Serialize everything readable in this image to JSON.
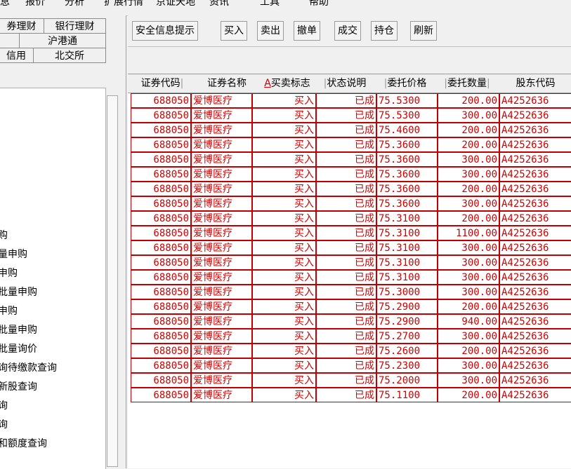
{
  "menu": {
    "items": [
      "息",
      "报价",
      "分析",
      "扩展行情",
      "京证天地",
      "资讯",
      "工具",
      "帮助"
    ]
  },
  "left": {
    "tabs": [
      "券理财",
      "银行理财",
      "沪港通",
      "信用",
      "北交所"
    ],
    "items": [
      "购",
      "量申购",
      "申购",
      "批量申购",
      "申购",
      "批量申购",
      "批量询价",
      "询待缴款查询",
      "新股查询",
      "询",
      "询",
      "和额度查询"
    ]
  },
  "toolbar": {
    "buttons": [
      "安全信息提示",
      "买入",
      "卖出",
      "撤单",
      "成交",
      "持仓",
      "刷新"
    ]
  },
  "table": {
    "headers": [
      "证券代码",
      "证券名称",
      "买卖标志",
      "状态说明",
      "委托价格",
      "委托数量",
      "股东代码"
    ],
    "sort_mark": "A",
    "rows": [
      [
        "688050",
        "爱博医疗",
        "买入",
        "已成",
        "75.5300",
        "200.00",
        "A4252636"
      ],
      [
        "688050",
        "爱博医疗",
        "买入",
        "已成",
        "75.5300",
        "300.00",
        "A4252636"
      ],
      [
        "688050",
        "爱博医疗",
        "买入",
        "已成",
        "75.4600",
        "200.00",
        "A4252636"
      ],
      [
        "688050",
        "爱博医疗",
        "买入",
        "已成",
        "75.3600",
        "200.00",
        "A4252636"
      ],
      [
        "688050",
        "爱博医疗",
        "买入",
        "已成",
        "75.3600",
        "300.00",
        "A4252636"
      ],
      [
        "688050",
        "爱博医疗",
        "买入",
        "已成",
        "75.3600",
        "300.00",
        "A4252636"
      ],
      [
        "688050",
        "爱博医疗",
        "买入",
        "已成",
        "75.3600",
        "200.00",
        "A4252636"
      ],
      [
        "688050",
        "爱博医疗",
        "买入",
        "已成",
        "75.3600",
        "300.00",
        "A4252636"
      ],
      [
        "688050",
        "爱博医疗",
        "买入",
        "已成",
        "75.3100",
        "200.00",
        "A4252636"
      ],
      [
        "688050",
        "爱博医疗",
        "买入",
        "已成",
        "75.3100",
        "1100.00",
        "A4252636"
      ],
      [
        "688050",
        "爱博医疗",
        "买入",
        "已成",
        "75.3100",
        "300.00",
        "A4252636"
      ],
      [
        "688050",
        "爱博医疗",
        "买入",
        "已成",
        "75.3100",
        "300.00",
        "A4252636"
      ],
      [
        "688050",
        "爱博医疗",
        "买入",
        "已成",
        "75.3100",
        "300.00",
        "A4252636"
      ],
      [
        "688050",
        "爱博医疗",
        "买入",
        "已成",
        "75.3000",
        "300.00",
        "A4252636"
      ],
      [
        "688050",
        "爱博医疗",
        "买入",
        "已成",
        "75.2900",
        "200.00",
        "A4252636"
      ],
      [
        "688050",
        "爱博医疗",
        "买入",
        "已成",
        "75.2900",
        "940.00",
        "A4252636"
      ],
      [
        "688050",
        "爱博医疗",
        "买入",
        "已成",
        "75.2700",
        "300.00",
        "A4252636"
      ],
      [
        "688050",
        "爱博医疗",
        "买入",
        "已成",
        "75.2600",
        "200.00",
        "A4252636"
      ],
      [
        "688050",
        "爱博医疗",
        "买入",
        "已成",
        "75.2300",
        "300.00",
        "A4252636"
      ],
      [
        "688050",
        "爱博医疗",
        "买入",
        "已成",
        "75.2000",
        "300.00",
        "A4252636"
      ],
      [
        "688050",
        "爱博医疗",
        "买入",
        "已成",
        "75.1100",
        "200.00",
        "A4252636"
      ]
    ]
  },
  "colors": {
    "text_red": "#d00000",
    "bg": "#f0f0f0"
  }
}
